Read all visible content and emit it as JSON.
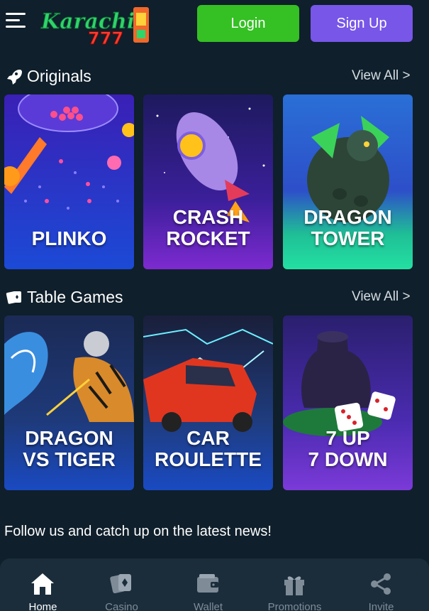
{
  "header": {
    "logo_text": "Karachi 777",
    "login_label": "Login",
    "signup_label": "Sign Up"
  },
  "sections": [
    {
      "title": "Originals",
      "icon": "rocket-icon",
      "view_all": "View All >",
      "games": [
        "PLINKO",
        "CRASH ROCKET",
        "DRAGON TOWER"
      ]
    },
    {
      "title": "Table Games",
      "icon": "playing-cards-icon",
      "view_all": "View All >",
      "games": [
        "DRAGON VS TIGER",
        "CAR ROULETTE",
        "7 UP 7 DOWN"
      ]
    }
  ],
  "follow_text": "Follow us and catch up on the latest news!",
  "bottom_nav": [
    {
      "label": "Home",
      "icon": "home-icon",
      "active": true
    },
    {
      "label": "Casino",
      "icon": "cards-icon",
      "active": false
    },
    {
      "label": "Wallet",
      "icon": "wallet-icon",
      "active": false
    },
    {
      "label": "Promotions",
      "icon": "gift-icon",
      "active": false
    },
    {
      "label": "Invite",
      "icon": "share-icon",
      "active": false
    }
  ],
  "colors": {
    "background": "#0f1f2b",
    "login": "#35c024",
    "signup": "#7756e8",
    "nav_bg": "#1b2d3b"
  }
}
